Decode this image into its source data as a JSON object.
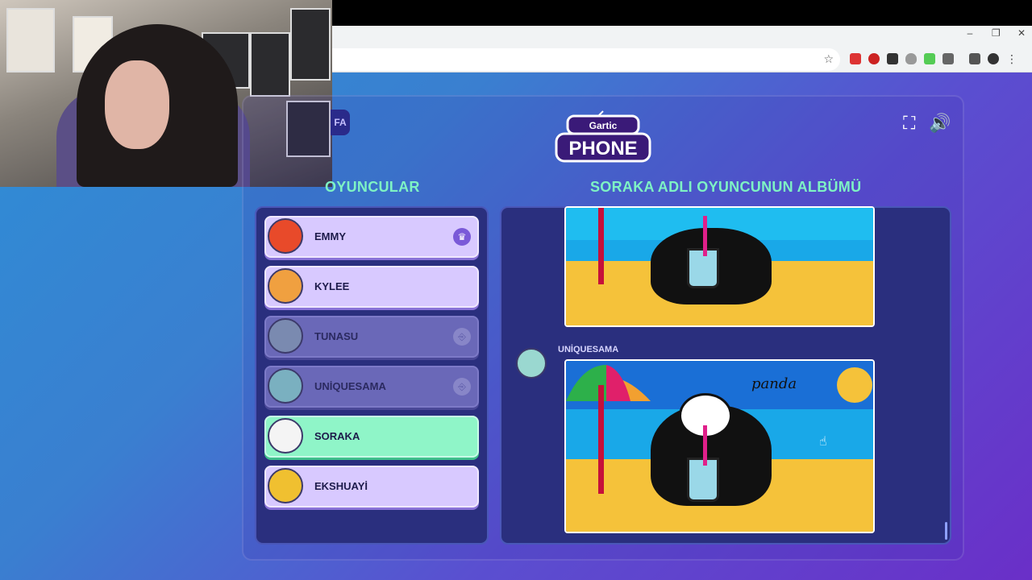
{
  "game": {
    "left_button_label": "FA",
    "logo_top": "Gartic",
    "logo_bottom": "PHONE",
    "players_heading": "OYUNCULAR",
    "album_heading": "SORAKA ADLI OYUNCUNUN ALBÜMÜ"
  },
  "players": [
    {
      "name": "EMMY"
    },
    {
      "name": "KYLEE"
    },
    {
      "name": "TUNASU"
    },
    {
      "name": "UNİQUESAMA"
    },
    {
      "name": "SORAKA"
    },
    {
      "name": "EKSHUAYİ"
    }
  ],
  "album": {
    "author": "UNİQUESAMA",
    "drawing_text": "panda"
  },
  "colors": {
    "accent_heading": "#7ef3c4",
    "player_card": "#d8c9ff",
    "selected_card": "#8ff5c8"
  }
}
